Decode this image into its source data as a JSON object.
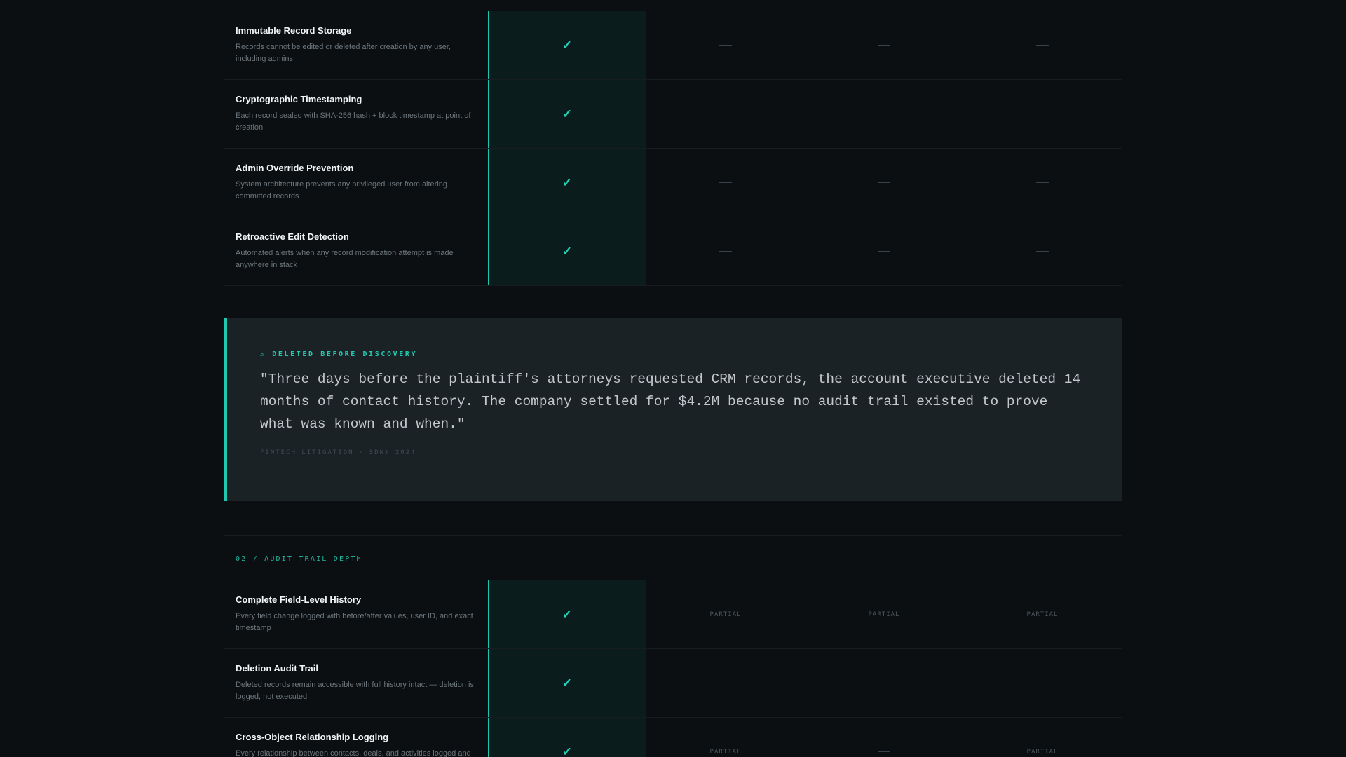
{
  "section1": {
    "rows": [
      {
        "title": "Immutable Record Storage",
        "desc": "Records cannot be edited or deleted after creation by any user, including admins",
        "cells": [
          "check",
          "dash",
          "dash",
          "dash"
        ]
      },
      {
        "title": "Cryptographic Timestamping",
        "desc": "Each record sealed with SHA-256 hash + block timestamp at point of creation",
        "cells": [
          "check",
          "dash",
          "dash",
          "dash"
        ]
      },
      {
        "title": "Admin Override Prevention",
        "desc": "System architecture prevents any privileged user from altering committed records",
        "cells": [
          "check",
          "dash",
          "dash",
          "dash"
        ]
      },
      {
        "title": "Retroactive Edit Detection",
        "desc": "Automated alerts when any record modification attempt is made anywhere in stack",
        "cells": [
          "check",
          "dash",
          "dash",
          "dash"
        ]
      }
    ]
  },
  "quote": {
    "label": "⚠ DELETED BEFORE DISCOVERY",
    "text": "\"Three days before the plaintiff's attorneys requested CRM records, the account executive deleted 14 months of contact history. The company settled for $4.2M because no audit trail existed to prove what was known and when.\"",
    "source": "FINTECH LITIGATION · SDNY 2024"
  },
  "section2": {
    "label": "02 / AUDIT TRAIL DEPTH",
    "partial_text": "PARTIAL",
    "rows": [
      {
        "title": "Complete Field-Level History",
        "desc": "Every field change logged with before/after values, user ID, and exact timestamp",
        "cells": [
          "check",
          "partial",
          "partial",
          "partial"
        ]
      },
      {
        "title": "Deletion Audit Trail",
        "desc": "Deleted records remain accessible with full history intact — deletion is logged, not executed",
        "cells": [
          "check",
          "dash",
          "dash",
          "dash"
        ]
      },
      {
        "title": "Cross-Object Relationship Logging",
        "desc": "Every relationship between contacts, deals, and activities logged and",
        "cells": [
          "check",
          "partial",
          "dash",
          "partial"
        ]
      }
    ]
  },
  "colors": {
    "accent": "#23d4bb",
    "background": "#0b0f12",
    "quote_bg": "#1b2226"
  },
  "icons": {
    "check": "check-icon",
    "dash": "dash-icon",
    "warning": "warning-icon"
  }
}
